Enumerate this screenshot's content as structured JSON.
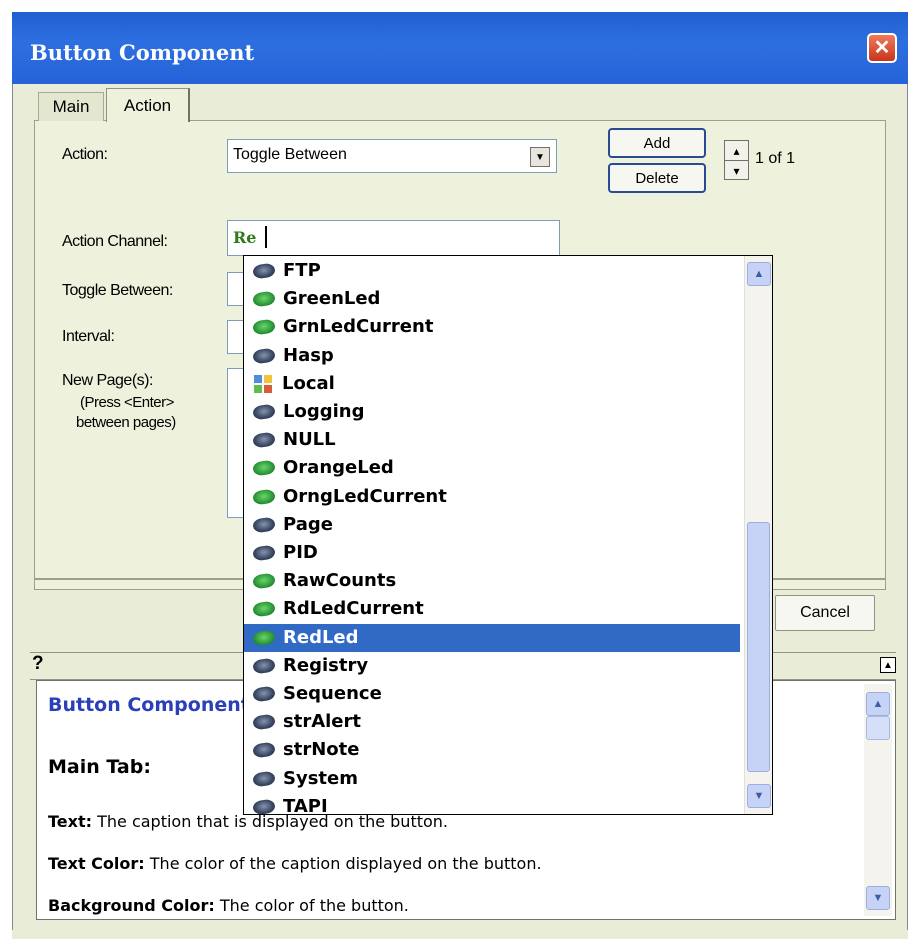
{
  "window": {
    "title": "Button Component",
    "close_label": "✕"
  },
  "tabs": [
    {
      "label": "Main"
    },
    {
      "label": "Action"
    }
  ],
  "form": {
    "action_label": "Action:",
    "action_value": "Toggle Between",
    "add_label": "Add",
    "delete_label": "Delete",
    "page_count": "1 of 1",
    "channel_label": "Action Channel:",
    "channel_value": "Re",
    "toggle_label": "Toggle Between:",
    "interval_label": "Interval:",
    "pages_label": "New Page(s):",
    "pages_hint1": "(Press <Enter>",
    "pages_hint2": "between pages)"
  },
  "buttons": {
    "cancel_label": "Cancel"
  },
  "help": {
    "q_label": "?",
    "title": "Button Component",
    "main_tab": "Main Tab:",
    "line1_term": "Text:",
    "line1_desc": " The caption that is displayed on the button.",
    "line2_term": "Text Color:",
    "line2_desc": " The color of the caption displayed on the button.",
    "line3_term": "Background Color:",
    "line3_desc": " The color of the button."
  },
  "autocomplete": {
    "selected": "RedLed",
    "items": [
      {
        "label": "FTP",
        "icon": "dark-channel-icon"
      },
      {
        "label": "GreenLed",
        "icon": "green-channel-icon"
      },
      {
        "label": "GrnLedCurrent",
        "icon": "green-channel-icon"
      },
      {
        "label": "Hasp",
        "icon": "dark-channel-icon"
      },
      {
        "label": "Local",
        "icon": "local-grid-icon"
      },
      {
        "label": "Logging",
        "icon": "dark-channel-icon"
      },
      {
        "label": "NULL",
        "icon": "dark-channel-icon"
      },
      {
        "label": "OrangeLed",
        "icon": "green-channel-icon"
      },
      {
        "label": "OrngLedCurrent",
        "icon": "green-channel-icon"
      },
      {
        "label": "Page",
        "icon": "dark-channel-icon"
      },
      {
        "label": "PID",
        "icon": "dark-channel-icon"
      },
      {
        "label": "RawCounts",
        "icon": "green-channel-icon"
      },
      {
        "label": "RdLedCurrent",
        "icon": "green-channel-icon"
      },
      {
        "label": "RedLed",
        "icon": "green-channel-icon"
      },
      {
        "label": "Registry",
        "icon": "dark-channel-icon"
      },
      {
        "label": "Sequence",
        "icon": "dark-channel-icon"
      },
      {
        "label": "strAlert",
        "icon": "dark-channel-icon"
      },
      {
        "label": "strNote",
        "icon": "dark-channel-icon"
      },
      {
        "label": "System",
        "icon": "dark-channel-icon"
      },
      {
        "label": "TAPI",
        "icon": "dark-channel-icon"
      }
    ]
  },
  "colors": {
    "titlebar": "#2563d8",
    "selection": "#316ac5",
    "dialog_bg": "#e9ecd6",
    "help_title": "#2a3fb8"
  }
}
